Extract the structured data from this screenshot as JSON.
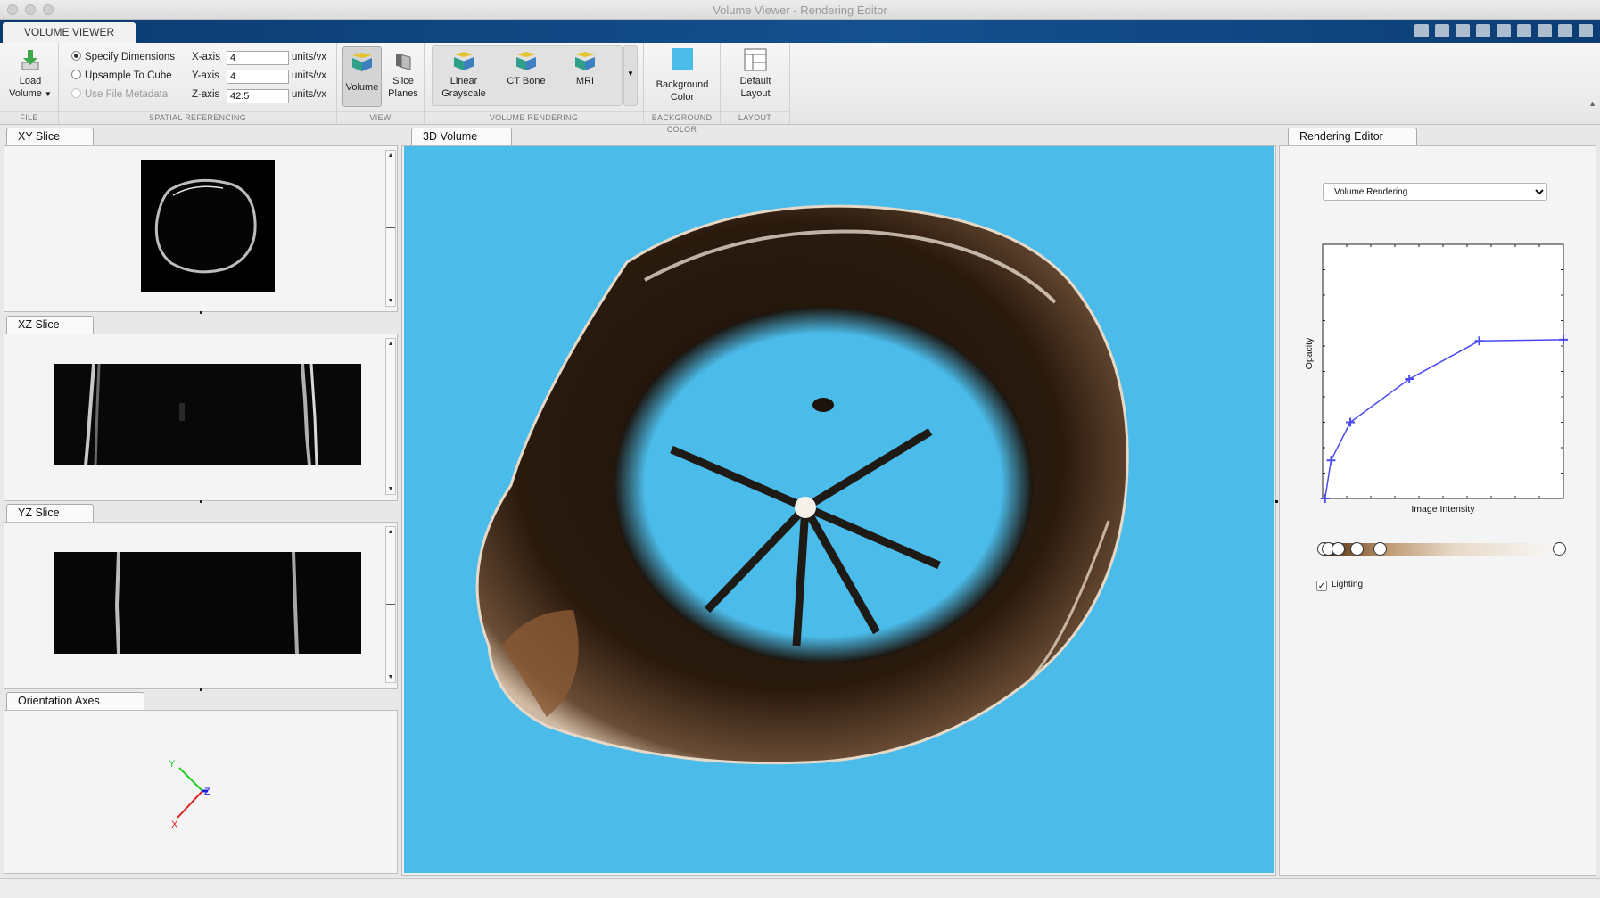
{
  "window": {
    "title": "Volume Viewer - Rendering Editor"
  },
  "ribbon_tab": "VOLUME VIEWER",
  "file": {
    "load_label_1": "Load",
    "load_label_2": "Volume",
    "section": "FILE"
  },
  "spatial": {
    "specify": "Specify Dimensions",
    "upsample": "Upsample To Cube",
    "metadata": "Use File Metadata",
    "x_label": "X-axis",
    "y_label": "Y-axis",
    "z_label": "Z-axis",
    "x_value": "4",
    "y_value": "4",
    "z_value": "42.5",
    "units": "units/vx",
    "section": "SPATIAL REFERENCING"
  },
  "view": {
    "volume": "Volume",
    "slice_1": "Slice",
    "slice_2": "Planes",
    "section": "VIEW"
  },
  "rendering": {
    "linear_1": "Linear",
    "linear_2": "Grayscale",
    "ct": "CT Bone",
    "mri": "MRI",
    "section": "VOLUME RENDERING"
  },
  "bg": {
    "label_1": "Background",
    "label_2": "Color",
    "section": "BACKGROUND COLOR",
    "color": "#4bbcea"
  },
  "layout": {
    "label_1": "Default",
    "label_2": "Layout",
    "section": "LAYOUT"
  },
  "panels": {
    "xy": "XY Slice",
    "xz": "XZ Slice",
    "yz": "YZ Slice",
    "orient": "Orientation Axes",
    "vol": "3D Volume",
    "editor": "Rendering Editor"
  },
  "axes": {
    "x": "X",
    "y": "Y",
    "z": "Z"
  },
  "editor": {
    "mode": "Volume Rendering",
    "xlabel": "Image Intensity",
    "ylabel": "Opacity",
    "lighting": "Lighting"
  },
  "chart_data": {
    "type": "line",
    "x": [
      0.01,
      0.035,
      0.115,
      0.36,
      0.65,
      1.0
    ],
    "y": [
      0.0,
      0.15,
      0.3,
      0.47,
      0.62,
      0.625
    ],
    "xlim": [
      0,
      1
    ],
    "ylim": [
      0,
      1
    ],
    "xlabel": "Image Intensity",
    "ylabel": "Opacity",
    "color": "#4a4af0"
  },
  "colormap_stops": [
    0.0,
    0.02,
    0.06,
    0.14,
    0.24,
    1.0
  ]
}
